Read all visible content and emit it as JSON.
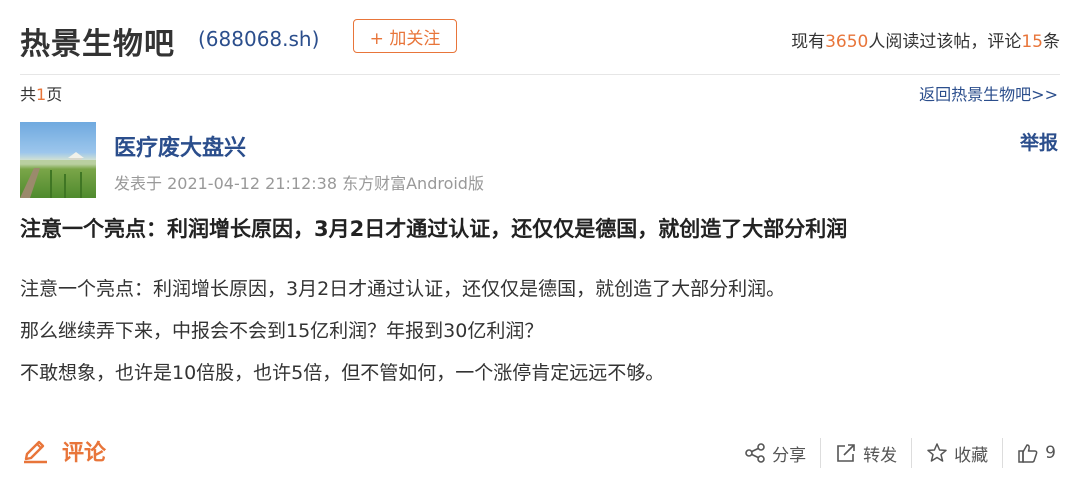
{
  "header": {
    "bar_title": "热景生物吧",
    "stock_code": "(688068.sh)",
    "follow_label": "+ 加关注",
    "stats_prefix": "现有",
    "read_count": "3650",
    "stats_mid": "人阅读过该帖，评论",
    "comment_count": "15",
    "stats_suffix": "条"
  },
  "pagination": {
    "prefix": "共",
    "total": "1",
    "suffix": "页",
    "back_link": "返回热景生物吧>>"
  },
  "post": {
    "author": "医疗废大盘兴",
    "meta": "发表于 2021-04-12 21:12:38 东方财富Android版",
    "report_label": "举报",
    "title": "注意一个亮点：利润增长原因，3月2日才通过认证，还仅仅是德国，就创造了大部分利润",
    "body": [
      "注意一个亮点：利润增长原因，3月2日才通过认证，还仅仅是德国，就创造了大部分利润。",
      "那么继续弄下来，中报会不会到15亿利润？年报到30亿利润？",
      "不敢想象，也许是10倍股，也许5倍，但不管如何，一个涨停肯定远远不够。"
    ]
  },
  "footer": {
    "comment_label": "评论",
    "share_label": "分享",
    "forward_label": "转发",
    "favorite_label": "收藏",
    "like_count": "9"
  },
  "colors": {
    "accent_orange": "#e8753a",
    "link_blue": "#2b4e8c",
    "meta_gray": "#999999"
  },
  "icons": {
    "comment": "pencil-icon",
    "share": "share-icon",
    "forward": "forward-icon",
    "favorite": "star-icon",
    "like": "thumbs-up-icon"
  }
}
